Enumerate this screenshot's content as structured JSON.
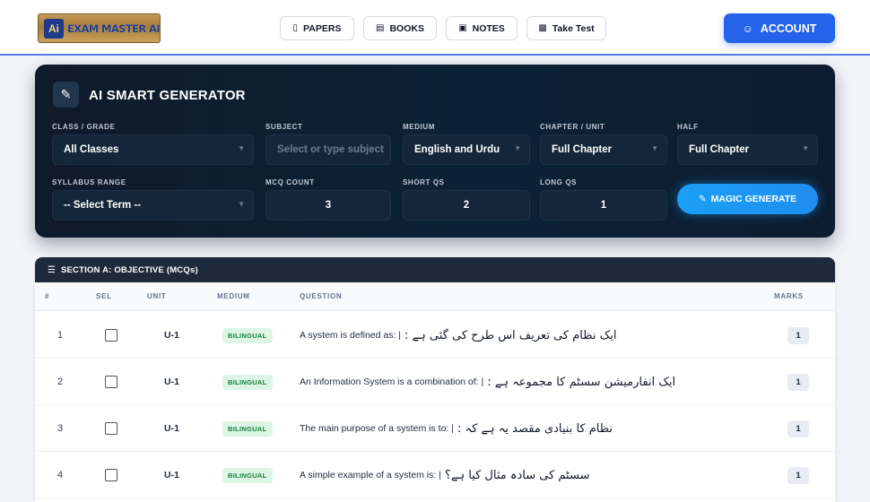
{
  "header": {
    "logo_text": "EXAM MASTER AI",
    "nav": [
      {
        "label": "PAPERS",
        "icon": "paper-icon"
      },
      {
        "label": "BOOKS",
        "icon": "book-icon"
      },
      {
        "label": "NOTES",
        "icon": "notes-icon"
      },
      {
        "label": "Take Test",
        "icon": "test-icon"
      }
    ],
    "account_label": "ACCOUNT",
    "accent_color": "#2563eb"
  },
  "generator": {
    "title": "AI SMART GENERATOR",
    "fields": {
      "class_grade": {
        "label": "CLASS / GRADE",
        "value": "All Classes"
      },
      "subject": {
        "label": "SUBJECT",
        "placeholder": "Select or type subject"
      },
      "medium": {
        "label": "MEDIUM",
        "value": "English and Urdu"
      },
      "chapter_unit": {
        "label": "CHAPTER / UNIT",
        "value": "Full Chapter"
      },
      "half": {
        "label": "HALF",
        "value": "Full Chapter"
      },
      "syllabus_range": {
        "label": "SYLLABUS RANGE",
        "value": "-- Select Term --"
      },
      "mcq_count": {
        "label": "MCQ COUNT",
        "value": "3"
      },
      "short_qs": {
        "label": "SHORT QS",
        "value": "2"
      },
      "long_qs": {
        "label": "LONG QS",
        "value": "1"
      }
    },
    "magic_button_label": "MAGIC GENERATE"
  },
  "section_a": {
    "title": "SECTION A: OBJECTIVE (MCQs)",
    "columns": {
      "num": "#",
      "sel": "SEL",
      "unit": "UNIT",
      "medium": "MEDIUM",
      "question": "QUESTION",
      "marks": "MARKS"
    },
    "rows": [
      {
        "num": "1",
        "unit": "U-1",
        "medium": "BILINGUAL",
        "question_en": "A system is defined as: |",
        "question_ur": "ایک نظام کی تعریف اس طرح کی گئی ہے :",
        "marks": "1"
      },
      {
        "num": "2",
        "unit": "U-1",
        "medium": "BILINGUAL",
        "question_en": "An Information System is a combination of: |",
        "question_ur": "ایک انفارمیشن سسٹم کا مجموعہ ہے :",
        "marks": "1"
      },
      {
        "num": "3",
        "unit": "U-1",
        "medium": "BILINGUAL",
        "question_en": "The main purpose of a system is to: |",
        "question_ur": "نظام کا بنیادی مقصد یہ ہے کہ :",
        "marks": "1"
      },
      {
        "num": "4",
        "unit": "U-1",
        "medium": "BILINGUAL",
        "question_en": "A simple example of a system is: |",
        "question_ur": "سسٹم کی سادہ مثال کیا ہے؟",
        "marks": "1"
      }
    ]
  }
}
